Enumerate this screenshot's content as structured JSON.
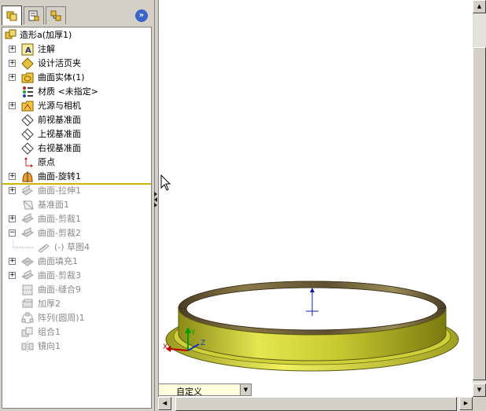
{
  "feature_tree": {
    "root": {
      "label": "造形a(加厚1)",
      "icon": "part-icon"
    },
    "items": [
      {
        "label": "注解",
        "icon": "annotation-icon",
        "expandable": true,
        "dimmed": false
      },
      {
        "label": "设计活页夹",
        "icon": "design-binder-icon",
        "expandable": true,
        "dimmed": false
      },
      {
        "label": "曲面实体(1)",
        "icon": "surface-bodies-folder-icon",
        "expandable": true,
        "dimmed": false
      },
      {
        "label": "材质 <未指定>",
        "icon": "material-icon",
        "expandable": false,
        "dimmed": false
      },
      {
        "label": "光源与相机",
        "icon": "lights-camera-icon",
        "expandable": true,
        "dimmed": false
      },
      {
        "label": "前视基准面",
        "icon": "plane-icon",
        "expandable": false,
        "dimmed": false
      },
      {
        "label": "上视基准面",
        "icon": "plane-icon",
        "expandable": false,
        "dimmed": false
      },
      {
        "label": "右视基准面",
        "icon": "plane-icon",
        "expandable": false,
        "dimmed": false
      },
      {
        "label": "原点",
        "icon": "origin-icon",
        "expandable": false,
        "dimmed": false
      },
      {
        "label": "曲面-旋转1",
        "icon": "surface-revolve-icon",
        "expandable": true,
        "dimmed": false
      },
      {
        "label": "曲面-拉伸1",
        "icon": "surface-extrude-icon",
        "expandable": true,
        "dimmed": true
      },
      {
        "label": "基准面1",
        "icon": "plane-icon",
        "expandable": false,
        "dimmed": true
      },
      {
        "label": "曲面-剪裁1",
        "icon": "surface-trim-icon",
        "expandable": true,
        "dimmed": true
      },
      {
        "label": "曲面-剪裁2",
        "icon": "surface-trim-icon",
        "expandable": true,
        "expanded": true,
        "dimmed": true
      },
      {
        "label": "(-) 草图4",
        "icon": "sketch-icon",
        "expandable": false,
        "dimmed": true,
        "child": true
      },
      {
        "label": "曲面填充1",
        "icon": "surface-fill-icon",
        "expandable": true,
        "dimmed": true
      },
      {
        "label": "曲面-剪裁3",
        "icon": "surface-trim-icon",
        "expandable": true,
        "dimmed": true
      },
      {
        "label": "曲面-缝合9",
        "icon": "surface-knit-icon",
        "expandable": false,
        "dimmed": true
      },
      {
        "label": "加厚2",
        "icon": "thicken-icon",
        "expandable": false,
        "dimmed": true
      },
      {
        "label": "阵列(圆周)1",
        "icon": "circular-pattern-icon",
        "expandable": false,
        "dimmed": true
      },
      {
        "label": "组合1",
        "icon": "combine-icon",
        "expandable": false,
        "dimmed": true
      },
      {
        "label": "镜向1",
        "icon": "mirror-icon",
        "expandable": false,
        "dimmed": true
      }
    ]
  },
  "manager_tabs": [
    {
      "name": "feature-manager-tab",
      "icon": "feature-tree-icon"
    },
    {
      "name": "property-manager-tab",
      "icon": "property-icon"
    },
    {
      "name": "configuration-manager-tab",
      "icon": "configuration-icon"
    }
  ],
  "collapse_button": {
    "label": "»"
  },
  "view_orientation": {
    "value": "自定义"
  },
  "triad": {
    "x": "X",
    "y": "Y",
    "z": "Z"
  },
  "colors": {
    "rollback_bar": "#c8b800",
    "model_yellow": "#d8d83a",
    "model_dark": "#6b5a3a",
    "dim_text": "#8a8a8a"
  }
}
